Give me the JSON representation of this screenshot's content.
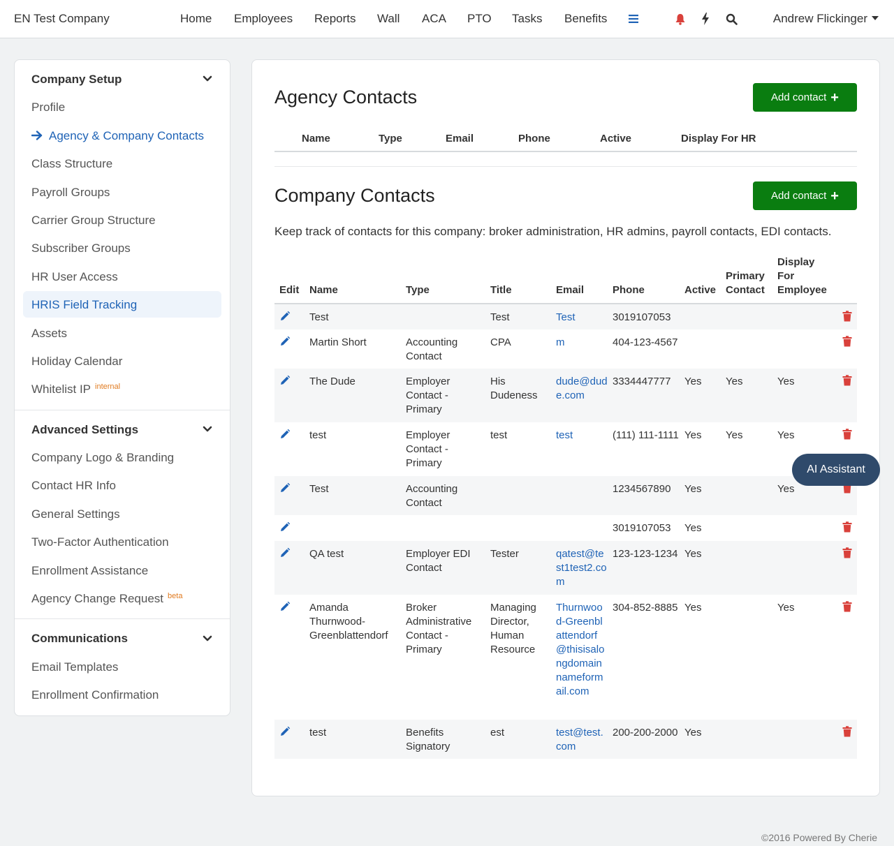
{
  "nav": {
    "brand": "EN Test Company",
    "links": [
      "Home",
      "Employees",
      "Reports",
      "Wall",
      "ACA",
      "PTO",
      "Tasks",
      "Benefits"
    ],
    "user": "Andrew Flickinger",
    "icons": [
      "menu-icon",
      "bell-icon",
      "bolt-icon",
      "search-icon"
    ]
  },
  "sidebar": {
    "sections": [
      {
        "title": "Company Setup",
        "items": [
          "Profile",
          "Agency & Company Contacts",
          "Class Structure",
          "Payroll Groups",
          "Carrier Group Structure",
          "Subscriber Groups",
          "HR User Access",
          "HRIS Field Tracking",
          "Assets",
          "Holiday Calendar",
          "Whitelist IP"
        ],
        "whitelist_tag": "internal"
      },
      {
        "title": "Advanced Settings",
        "items": [
          "Company Logo & Branding",
          "Contact HR Info",
          "General Settings",
          "Two-Factor Authentication",
          "Enrollment Assistance",
          "Agency Change Request"
        ],
        "agency_change_tag": "beta"
      },
      {
        "title": "Communications",
        "items": [
          "Email Templates",
          "Enrollment Confirmation"
        ]
      }
    ]
  },
  "agency": {
    "title": "Agency Contacts",
    "add_label": "Add contact",
    "columns": [
      "Name",
      "Type",
      "Email",
      "Phone",
      "Active",
      "Display For HR"
    ]
  },
  "company": {
    "title": "Company Contacts",
    "add_label": "Add contact",
    "description": "Keep track of contacts for this company: broker administration, HR admins, payroll contacts, EDI contacts.",
    "columns": {
      "edit": "Edit",
      "name": "Name",
      "type": "Type",
      "title": "Title",
      "email": "Email",
      "phone": "Phone",
      "active": "Active",
      "primary": "Primary Contact",
      "display": "Display For Employee"
    },
    "rows": [
      {
        "name": "Test",
        "type": "",
        "title": "Test",
        "email": "Test",
        "phone": "3019107053",
        "active": "",
        "primary": "",
        "display": ""
      },
      {
        "name": "Martin Short",
        "type": "Accounting Contact",
        "title": "CPA",
        "email": "m",
        "phone": "404-123-4567",
        "active": "",
        "primary": "",
        "display": ""
      },
      {
        "name": "The Dude",
        "type": "Employer Contact - Primary",
        "title": "His Dudeness",
        "email": "dude@dude.com",
        "phone": "3334447777",
        "active": "Yes",
        "primary": "Yes",
        "display": "Yes"
      },
      {
        "name": "test",
        "type": "Employer Contact - Primary",
        "title": "test",
        "email": "test",
        "phone": "(111) 111-1111",
        "active": "Yes",
        "primary": "Yes",
        "display": "Yes"
      },
      {
        "name": "Test",
        "type": "Accounting Contact",
        "title": "",
        "email": "",
        "phone": "1234567890",
        "active": "Yes",
        "primary": "",
        "display": "Yes"
      },
      {
        "name": "",
        "type": "",
        "title": "",
        "email": "",
        "phone": "3019107053",
        "active": "Yes",
        "primary": "",
        "display": ""
      },
      {
        "name": "QA test",
        "type": "Employer EDI Contact",
        "title": "Tester",
        "email": "qatest@test1test2.com",
        "phone": "123-123-1234",
        "active": "Yes",
        "primary": "",
        "display": ""
      },
      {
        "name": "Amanda Thurnwood-Greenblattendorf",
        "type": "Broker Administrative Contact - Primary",
        "title": "Managing Director, Human Resource",
        "email": "Thurnwood-Greenblattendorf@thisisalongdomainnameformail.com",
        "phone": "304-852-8885",
        "active": "Yes",
        "primary": "",
        "display": "Yes"
      },
      {
        "name": "test",
        "type": "Benefits Signatory",
        "title": "est",
        "email": "test@test.com",
        "phone": "200-200-2000",
        "active": "Yes",
        "primary": "",
        "display": ""
      }
    ]
  },
  "ai_assistant": "AI Assistant",
  "footer": "©2016 Powered By Cherie"
}
